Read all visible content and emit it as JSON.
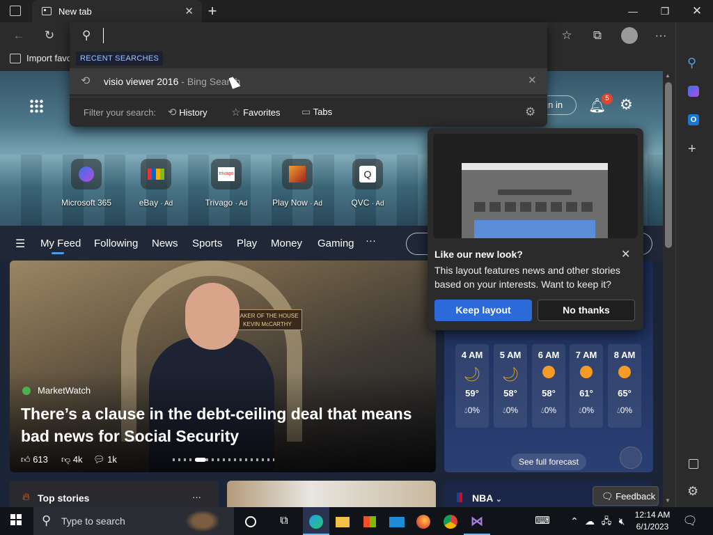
{
  "tab": {
    "title": "New tab"
  },
  "bookmarks": {
    "import_label": "Import favo"
  },
  "omnibox": {
    "section_label": "RECENT SEARCHES",
    "recent_query": "visio viewer 2016",
    "recent_suffix": "- Bing Search",
    "filter_label": "Filter your search:",
    "filters": [
      "History",
      "Favorites",
      "Tabs"
    ]
  },
  "header": {
    "signin_label": "gn in",
    "notification_count": "5"
  },
  "quick_links": [
    {
      "label": "Microsoft 365",
      "ad": ""
    },
    {
      "label": "eBay",
      "ad": "· Ad"
    },
    {
      "label": "Trivago",
      "ad": "· Ad"
    },
    {
      "label": "Play Now",
      "ad": "· Ad"
    },
    {
      "label": "QVC",
      "ad": "· Ad"
    }
  ],
  "quick_link_tile_texts": {
    "trivago": "trivago",
    "qvc": "Q"
  },
  "feed_nav": [
    "My Feed",
    "Following",
    "News",
    "Sports",
    "Play",
    "Money",
    "Gaming",
    "···"
  ],
  "main_story": {
    "source": "MarketWatch",
    "headline": "There’s a clause in the debt-ceiling deal that means bad news for Social Security",
    "likes": "613",
    "dislikes": "4k",
    "comments": "1k",
    "sign_text": "EAKER OF THE HOUSE\nKEVIN McCARTHY"
  },
  "weather": {
    "hours": [
      {
        "time": "4 AM",
        "icon": "moon",
        "temp": "59°",
        "precip": "0%"
      },
      {
        "time": "5 AM",
        "icon": "moon",
        "temp": "58°",
        "precip": "0%"
      },
      {
        "time": "6 AM",
        "icon": "sun",
        "temp": "58°",
        "precip": "0%"
      },
      {
        "time": "7 AM",
        "icon": "sun",
        "temp": "61°",
        "precip": "0%"
      },
      {
        "time": "8 AM",
        "icon": "sun",
        "temp": "65°",
        "precip": "0%"
      }
    ],
    "forecast_button": "See full forecast"
  },
  "bottom": {
    "top_stories": "Top stories",
    "more": "···",
    "nba": "NBA",
    "feedback": "Feedback"
  },
  "popup": {
    "title": "Like our new look?",
    "body": "This layout features news and other stories based on your interests. Want to keep it?",
    "keep": "Keep layout",
    "decline": "No thanks"
  },
  "taskbar": {
    "search_placeholder": "Type to search",
    "time": "12:14 AM",
    "date": "6/1/2023"
  },
  "colors": {
    "accent": "#2b6ad8",
    "titlebar": "#202020",
    "toolbar": "#2b2b2b",
    "taskbar": "#101318"
  }
}
